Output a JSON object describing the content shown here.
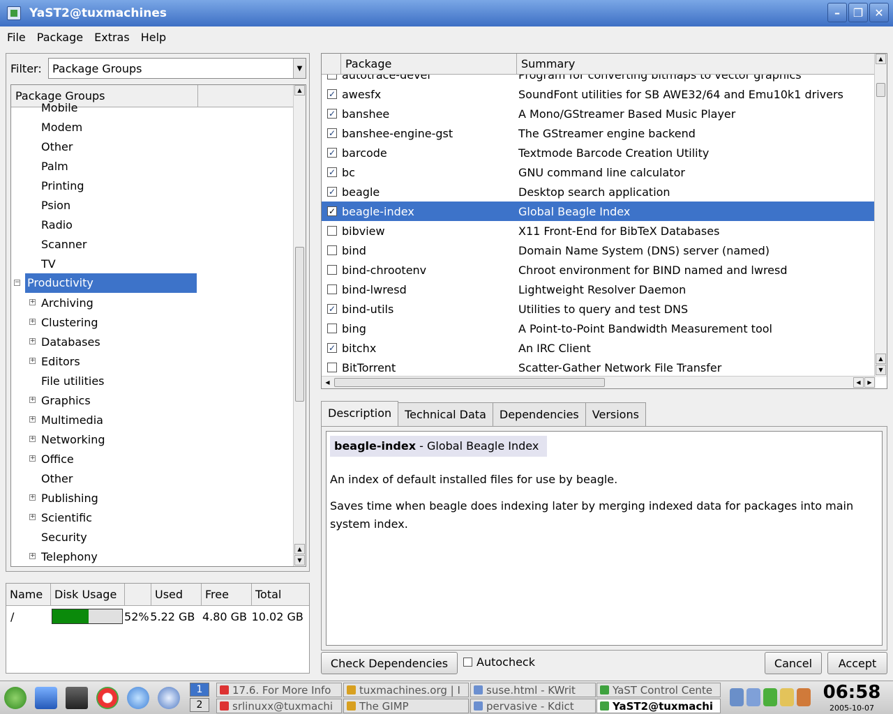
{
  "window": {
    "title": "YaST2@tuxmachines"
  },
  "menu": [
    "File",
    "Package",
    "Extras",
    "Help"
  ],
  "filter": {
    "label": "Filter:",
    "value": "Package Groups"
  },
  "tree": {
    "header": "Package Groups",
    "items": [
      {
        "label": "Mobile",
        "level": 2,
        "expander": false
      },
      {
        "label": "Modem",
        "level": 2,
        "expander": false
      },
      {
        "label": "Other",
        "level": 2,
        "expander": false
      },
      {
        "label": "Palm",
        "level": 2,
        "expander": false
      },
      {
        "label": "Printing",
        "level": 2,
        "expander": false
      },
      {
        "label": "Psion",
        "level": 2,
        "expander": false
      },
      {
        "label": "Radio",
        "level": 2,
        "expander": false
      },
      {
        "label": "Scanner",
        "level": 2,
        "expander": false
      },
      {
        "label": "TV",
        "level": 2,
        "expander": false
      },
      {
        "label": "Productivity",
        "level": 1,
        "expander": "minus",
        "selected": true
      },
      {
        "label": "Archiving",
        "level": 2,
        "expander": "plus"
      },
      {
        "label": "Clustering",
        "level": 2,
        "expander": "plus"
      },
      {
        "label": "Databases",
        "level": 2,
        "expander": "plus"
      },
      {
        "label": "Editors",
        "level": 2,
        "expander": "plus"
      },
      {
        "label": "File utilities",
        "level": 2,
        "expander": false
      },
      {
        "label": "Graphics",
        "level": 2,
        "expander": "plus"
      },
      {
        "label": "Multimedia",
        "level": 2,
        "expander": "plus"
      },
      {
        "label": "Networking",
        "level": 2,
        "expander": "plus"
      },
      {
        "label": "Office",
        "level": 2,
        "expander": "plus"
      },
      {
        "label": "Other",
        "level": 2,
        "expander": false
      },
      {
        "label": "Publishing",
        "level": 2,
        "expander": "plus"
      },
      {
        "label": "Scientific",
        "level": 2,
        "expander": "plus"
      },
      {
        "label": "Security",
        "level": 2,
        "expander": false
      },
      {
        "label": "Telephony",
        "level": 2,
        "expander": "plus"
      }
    ]
  },
  "disk": {
    "headers": [
      "Name",
      "Disk Usage",
      "",
      "Used",
      "Free",
      "Total"
    ],
    "rows": [
      {
        "name": "/",
        "usage_fraction": 0.52,
        "percent": "52%",
        "used": "5.22 GB",
        "free": "4.80 GB",
        "total": "10.02 GB"
      }
    ]
  },
  "packages": {
    "headers": [
      "Package",
      "Summary"
    ],
    "rows": [
      {
        "name": "autotrace-devel",
        "summary": "Program for converting bitmaps to vector graphics",
        "checked": false
      },
      {
        "name": "awesfx",
        "summary": "SoundFont utilities for SB AWE32/64 and Emu10k1 drivers",
        "checked": true
      },
      {
        "name": "banshee",
        "summary": "A Mono/GStreamer Based Music Player",
        "checked": true
      },
      {
        "name": "banshee-engine-gst",
        "summary": "The GStreamer engine backend",
        "checked": true
      },
      {
        "name": "barcode",
        "summary": "Textmode Barcode Creation Utility",
        "checked": true
      },
      {
        "name": "bc",
        "summary": "GNU command line calculator",
        "checked": true
      },
      {
        "name": "beagle",
        "summary": "Desktop search application",
        "checked": true
      },
      {
        "name": "beagle-index",
        "summary": "Global Beagle Index",
        "checked": true,
        "selected": true
      },
      {
        "name": "bibview",
        "summary": "X11 Front-End for BibTeX Databases",
        "checked": false
      },
      {
        "name": "bind",
        "summary": "Domain Name System (DNS) server (named)",
        "checked": false
      },
      {
        "name": "bind-chrootenv",
        "summary": "Chroot environment for BIND named and lwresd",
        "checked": false
      },
      {
        "name": "bind-lwresd",
        "summary": "Lightweight Resolver Daemon",
        "checked": false
      },
      {
        "name": "bind-utils",
        "summary": "Utilities to query and test DNS",
        "checked": true
      },
      {
        "name": "bing",
        "summary": "A Point-to-Point Bandwidth Measurement tool",
        "checked": false
      },
      {
        "name": "bitchx",
        "summary": "An IRC Client",
        "checked": true
      },
      {
        "name": "BitTorrent",
        "summary": "Scatter-Gather Network File Transfer",
        "checked": false
      }
    ]
  },
  "tabs": [
    "Description",
    "Technical Data",
    "Dependencies",
    "Versions"
  ],
  "description": {
    "name": "beagle-index",
    "sep": " - ",
    "summary": "Global Beagle Index",
    "p1": "An index of default installed files for use by beagle.",
    "p2": "Saves time when beagle does indexing later by merging indexed data for packages into main system index."
  },
  "buttons": {
    "check_deps": "Check Dependencies",
    "autocheck": "Autocheck",
    "cancel": "Cancel",
    "accept": "Accept"
  },
  "taskbar": {
    "pager": [
      "1",
      "2"
    ],
    "tasks": [
      {
        "label": "17.6. For More Info",
        "row": 0,
        "col": 0
      },
      {
        "label": "tuxmachines.org | I",
        "row": 0,
        "col": 1
      },
      {
        "label": "suse.html - KWrit",
        "row": 0,
        "col": 2
      },
      {
        "label": "YaST Control Cente",
        "row": 0,
        "col": 3
      },
      {
        "label": "srlinuxx@tuxmachi",
        "row": 1,
        "col": 0
      },
      {
        "label": "The GIMP",
        "row": 1,
        "col": 1
      },
      {
        "label": "pervasive - Kdict",
        "row": 1,
        "col": 2
      },
      {
        "label": "YaST2@tuxmachi",
        "row": 1,
        "col": 3,
        "active": true
      }
    ],
    "clock_time": "06:58",
    "clock_date": "2005-10-07"
  },
  "colors": {
    "selection": "#3d73c9",
    "titlebar": "#4a7ccc",
    "disk_bar": "#0b8a0b"
  }
}
